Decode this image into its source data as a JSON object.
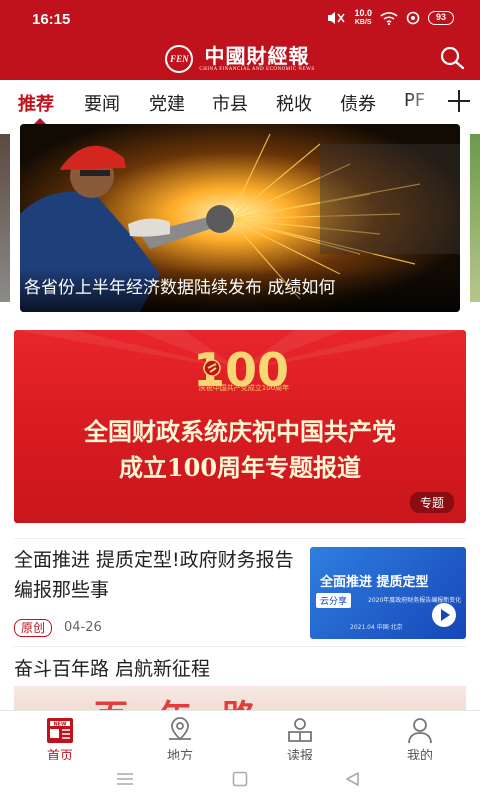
{
  "status_bar": {
    "time": "16:15",
    "net_speed_value": "10.0",
    "net_speed_unit": "KB/S",
    "battery": "93"
  },
  "header": {
    "logo_mark": "FEN",
    "name_cn": "中國財經報",
    "name_en": "CHINA FINANCIAL AND ECONOMIC NEWS",
    "search_icon": "search-icon"
  },
  "tabs": [
    "推荐",
    "要闻",
    "党建",
    "市县",
    "税收",
    "债券",
    "PF"
  ],
  "active_tab": "推荐",
  "banner": {
    "caption": "各省份上半年经济数据陆续发布 成绩如何"
  },
  "topic": {
    "emblem_number": "100",
    "emblem_caption": "庆祝中国共产党成立100周年",
    "title_line1": "全国财政系统庆祝中国共产党",
    "title_line2": "成立100周年专题报道",
    "badge": "专题"
  },
  "news": [
    {
      "title": "全面推进 提质定型!政府财务报告编报那些事",
      "tag": "原创",
      "date": "04-26",
      "thumb_headline": "全面推进 提质定型",
      "thumb_label": "云分享",
      "thumb_subtitle": "2020年度政府财务报告编报新变化",
      "thumb_footer": "2021.04 中国·北京"
    }
  ],
  "section": {
    "title": "奋斗百年路 启航新征程",
    "image_text": "百年路"
  },
  "bottom_nav": [
    {
      "label": "首页",
      "icon": "news-icon",
      "active": true
    },
    {
      "label": "地方",
      "icon": "location-icon",
      "active": false
    },
    {
      "label": "读报",
      "icon": "reader-icon",
      "active": false
    },
    {
      "label": "我的",
      "icon": "profile-icon",
      "active": false
    }
  ],
  "colors": {
    "brand_red": "#c0121c",
    "topic_red": "#d51a20",
    "accent_gold": "#f5d16a"
  }
}
